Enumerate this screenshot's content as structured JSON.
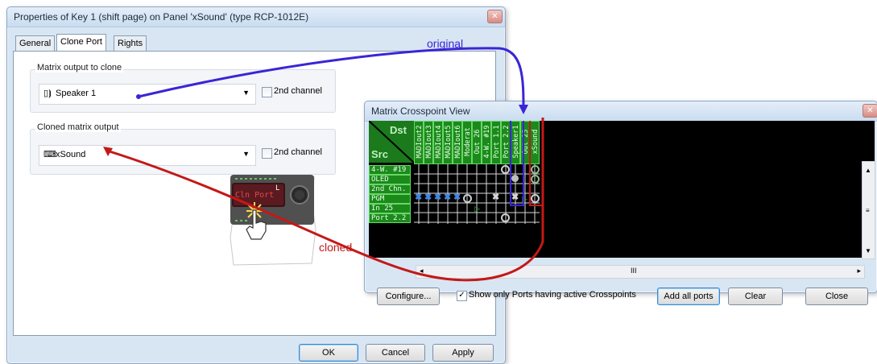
{
  "dialog": {
    "title": "Properties of Key 1 (shift page) on Panel 'xSound' (type RCP-1012E)",
    "close_glyph": "✕",
    "tabs": [
      "General",
      "Clone Port",
      "Rights"
    ],
    "group1": {
      "label": "Matrix output to clone",
      "value": "Speaker 1",
      "icon": "speaker-icon",
      "checkbox_label": "2nd channel"
    },
    "group2": {
      "label": "Cloned matrix output",
      "value": "xSound",
      "icon": "keyboard-icon",
      "checkbox_label": "2nd channel"
    },
    "buttons": {
      "ok": "OK",
      "cancel": "Cancel",
      "apply": "Apply"
    }
  },
  "panel_key": {
    "label": "Cln Port",
    "corner": "L"
  },
  "matrix_window": {
    "title": "Matrix Crosspoint View",
    "close_glyph": "✕",
    "dst_label": "Dst",
    "src_label": "Src",
    "sources": [
      "4-W. #19",
      "OLED",
      "2nd Chn.",
      "PGM",
      "In 25",
      "Port 2.2"
    ],
    "destinations": [
      "MADIout2",
      "MADIout3",
      "MADIout4",
      "MADIout5",
      "MADIout6",
      "Moderat",
      "Out 26",
      "4-W. #19",
      "Port 1.1",
      "Port 2.2",
      "Speaker1",
      "Out 25",
      "xSound"
    ],
    "scroll_label": "III",
    "buttons": {
      "configure": "Configure...",
      "show_only_label": "Show only Ports having active Crosspoints",
      "add_all": "Add all ports",
      "clear": "Clear",
      "close": "Close"
    }
  },
  "annotations": {
    "original": "original",
    "cloned": "cloned"
  },
  "colors": {
    "original": "#3a25d6",
    "cloned": "#c41818",
    "matrix_bg": "#000000",
    "port_green": "#1b8a1b",
    "crosspoint_blue": "#3f86e8"
  }
}
